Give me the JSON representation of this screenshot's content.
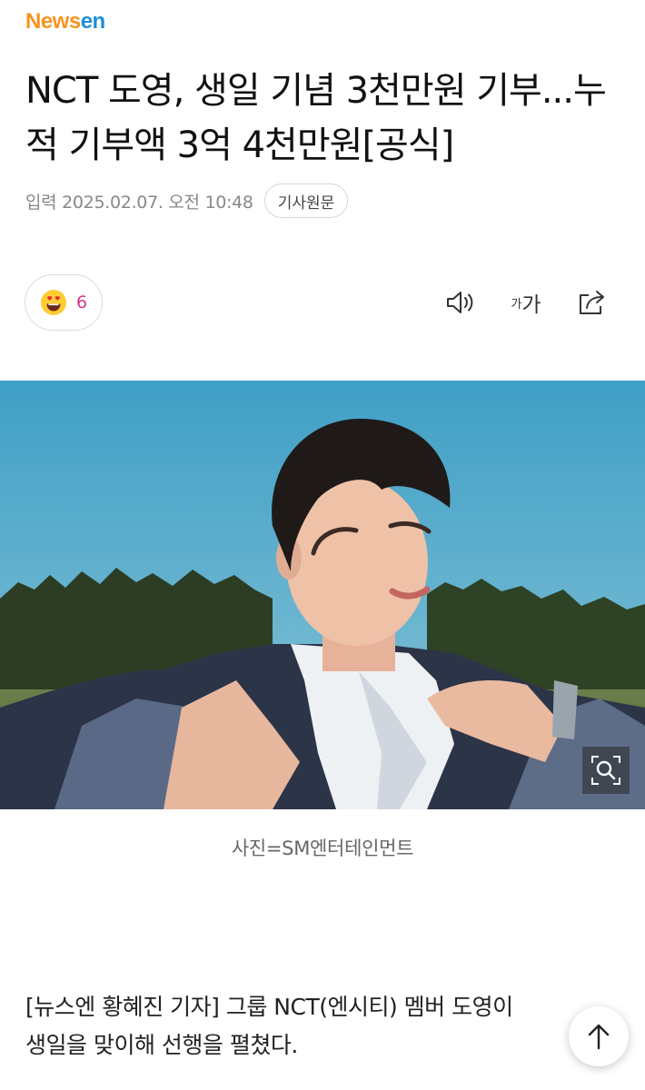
{
  "header": {
    "logo_part1": "News",
    "logo_part2": "en"
  },
  "article": {
    "headline": "NCT 도영, 생일 기념 3천만원 기부...누적 기부액 3억 4천만원[공식]",
    "date": "입력 2025.02.07. 오전 10:48",
    "source_button": "기사원문"
  },
  "toolbar": {
    "reaction_count": "6",
    "reaction_icon": "heart-eyes-emoji-icon",
    "audio_icon": "speaker-icon",
    "font_small": "가",
    "font_large": "가",
    "share_icon": "share-icon"
  },
  "photo": {
    "caption": "사진=SM엔터테인먼트",
    "zoom_icon": "zoom-search-icon"
  },
  "body": {
    "text": "[뉴스엔 황혜진 기자] 그룹 NCT(엔시티) 멤버 도영이\n생일을 맞이해 선행을 펼쳤다."
  },
  "colors": {
    "logo_orange": "#f7931e",
    "logo_blue": "#1f8ed6",
    "reaction_count": "#d6338a"
  }
}
